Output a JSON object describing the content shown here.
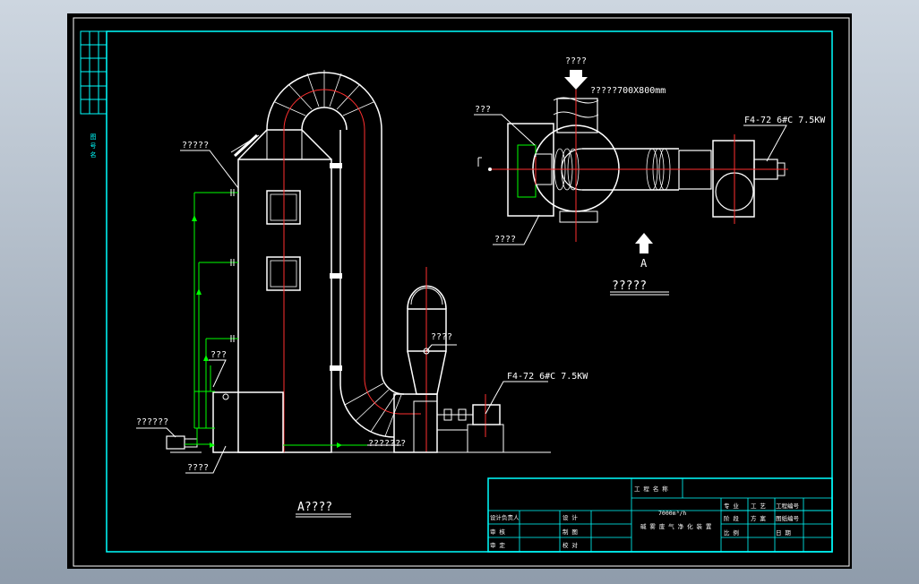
{
  "side_labels": [
    "图",
    "号",
    "名"
  ],
  "elevation": {
    "label_tower": "?????",
    "label_pipe": "???",
    "label_pump": "??????",
    "label_tank": "????",
    "label_damper": "????",
    "label_level": "???????",
    "fan_label": "F4-72 6#C 7.5KW",
    "caption": "A????"
  },
  "plan": {
    "label_inlet": "????",
    "inlet_size": "?????700X800mm",
    "label_top_left": "???",
    "label_bottom_left": "????",
    "fan_label": "F4-72 6#C 7.5KW",
    "view_arrow_label": "A",
    "caption": "?????"
  },
  "title_block": {
    "project_label": "工 程 名 称",
    "capacity": "7000m³/h",
    "drawing_name": "碱 雾 废 气 净 化 装 置",
    "rows_left": [
      "设计负责人",
      "审 核",
      "审 定"
    ],
    "rows_mid": [
      "设 计",
      "制 图",
      "校 对"
    ],
    "r1": [
      "专 业",
      "工 艺",
      "工程编号"
    ],
    "r2": [
      "阶 段",
      "方 案",
      "图纸编号"
    ],
    "r3": [
      "比 例",
      "",
      "日 期"
    ]
  }
}
